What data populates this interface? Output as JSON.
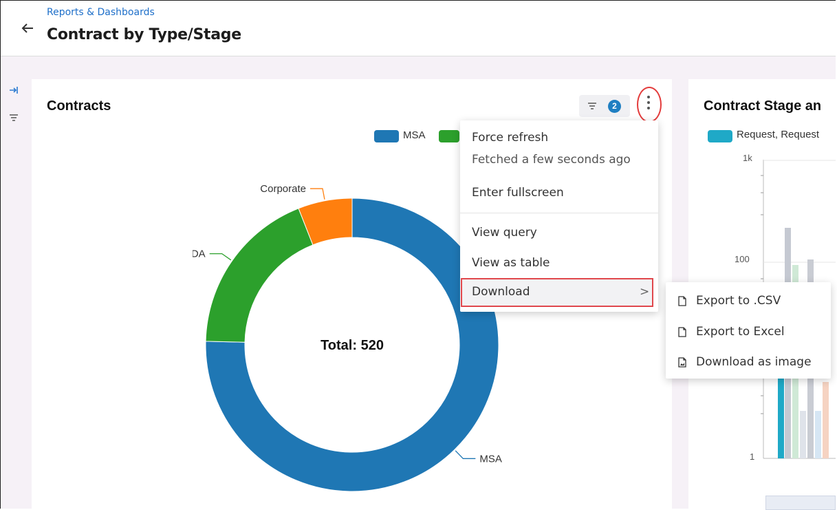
{
  "header": {
    "breadcrumb": "Reports & Dashboards",
    "title": "Contract by Type/Stage"
  },
  "rail": {
    "expand_icon": "expand-panel-icon",
    "filter_icon": "filter-icon"
  },
  "card1": {
    "title": "Contracts",
    "filter_count": "2",
    "legend": [
      {
        "label": "MSA",
        "color": "#1f77b4"
      },
      {
        "label": "",
        "color": "#2ca02c"
      }
    ],
    "center_label": "Total: 520"
  },
  "chart_data": {
    "type": "pie",
    "title": "Contracts",
    "categories": [
      "MSA",
      "NDA",
      "Corporate"
    ],
    "values": [
      392,
      97,
      31
    ],
    "colors": [
      "#1f77b4",
      "#2ca02c",
      "#ff7f0e"
    ],
    "center_text": "Total: 520",
    "donut": true
  },
  "menu": {
    "force_refresh": "Force refresh",
    "fetched": "Fetched a few seconds ago",
    "fullscreen": "Enter fullscreen",
    "view_query": "View query",
    "view_table": "View as table",
    "download": "Download",
    "chevron": ">"
  },
  "submenu": {
    "csv": "Export to .CSV",
    "excel": "Export to Excel",
    "image": "Download as image"
  },
  "card2": {
    "title": "Contract Stage an",
    "legend_label": "Request, Request",
    "legend_color": "#1fa9c7",
    "ticks": [
      "1k",
      "100",
      "1"
    ]
  }
}
